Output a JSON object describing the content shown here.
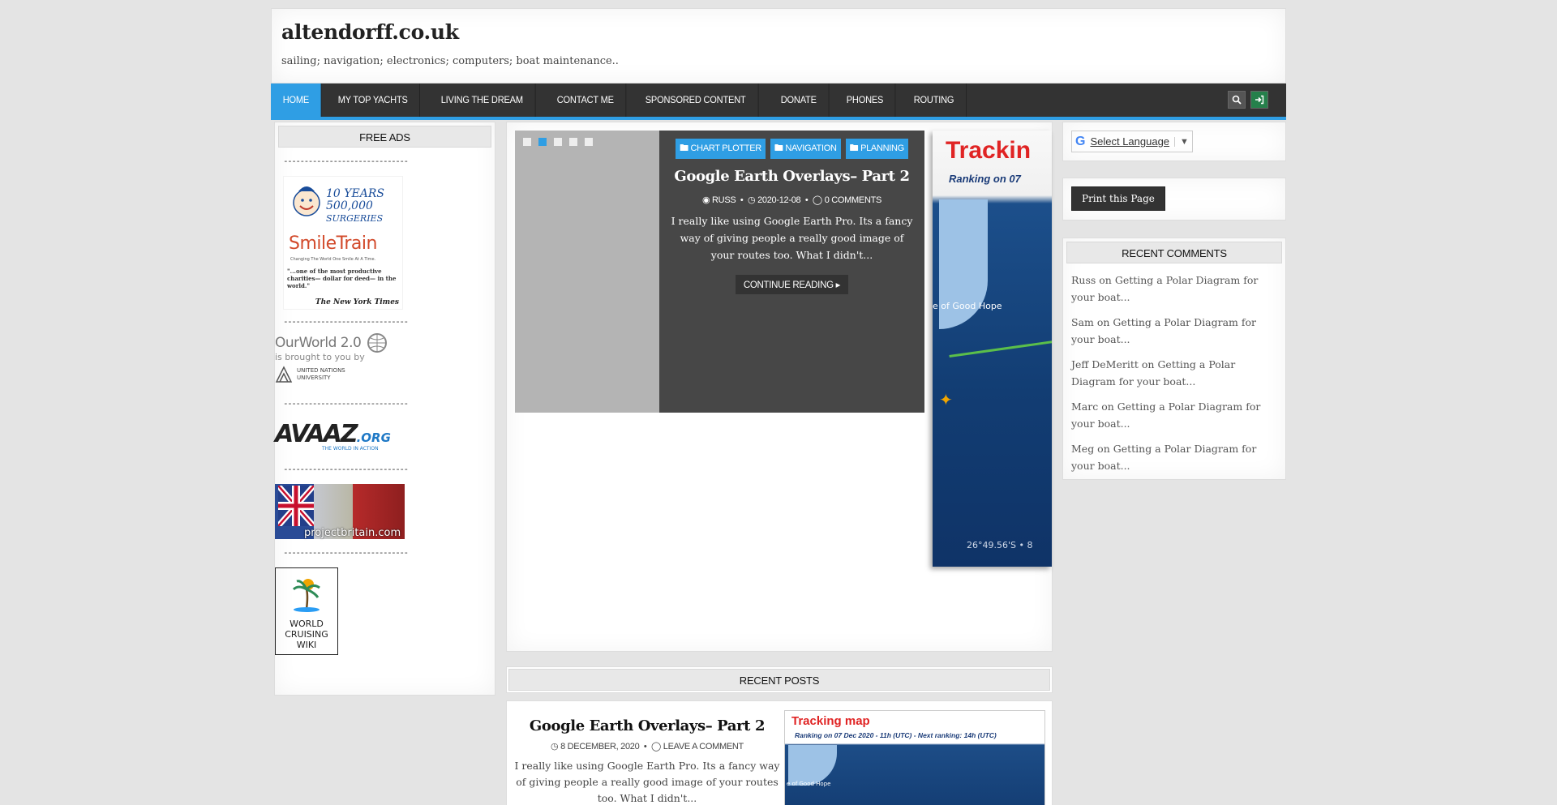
{
  "site": {
    "title": "altendorff.co.uk",
    "tagline": "sailing; navigation; electronics; computers; boat maintenance.."
  },
  "nav": {
    "items": [
      "Home",
      "My Top Yachts",
      "Living the Dream",
      "Contact Me",
      "Sponsored Content",
      "Donate",
      "Phones",
      "Routing"
    ],
    "active_index": 0,
    "search_icon": "search-icon",
    "login_icon": "login-icon"
  },
  "left_sidebar": {
    "title": "Free Ads",
    "divider": "------------------------------",
    "ads": {
      "smiletrain": {
        "line1": "10 YEARS",
        "line2": "500,000",
        "line3": "SURGERIES",
        "brand": "SmileTrain",
        "sub": "Changing The World One Smile At A Time.",
        "quote": "\"...one of the most productive charities— dollar for deed— in the world.\"",
        "source": "The New York Times"
      },
      "ourworld": {
        "line1": "OurWorld 2.0",
        "line2": "is brought to you by",
        "line3": "UNITED NATIONS",
        "line4": "UNIVERSITY"
      },
      "avaaz": {
        "brand": "AVAAZ",
        "suffix": ".ORG",
        "tagline": "THE WORLD IN ACTION"
      },
      "britain": {
        "caption": "projectbritain.com"
      },
      "wcw": {
        "text": "WORLD CRUISING WIKI"
      }
    }
  },
  "slider": {
    "dots": 5,
    "active_dot": 1,
    "categories": [
      "Chart Plotter",
      "Navigation",
      "Planning"
    ],
    "title": "Google Earth Overlays– Part 2",
    "author": "Russ",
    "date": "2020-12-08",
    "comments": "0 Comments",
    "excerpt": "I really like using Google Earth Pro. Its a fancy way of giving people a really good image of your routes too. What I didn't...",
    "button": "Continue Reading",
    "next_preview": {
      "title": "Trackin",
      "subtitle": "Ranking on 07",
      "place": "e of Good Hope",
      "coords": "26°49.56'S • 8"
    }
  },
  "recent_posts": {
    "title": "Recent Posts",
    "items": [
      {
        "title": "Google Earth Overlays– Part 2",
        "date": "8 December, 2020",
        "comment_link": "Leave a Comment",
        "excerpt": "I really like using Google Earth Pro. Its a fancy way of giving people a really good image of your routes too. What I didn't...",
        "thumb_title": "Tracking map",
        "thumb_subtitle": "Ranking on 07 Dec 2020 - 11h (UTC) - Next ranking: 14h (UTC)",
        "thumb_place": "e of Good Hope"
      }
    ]
  },
  "right_sidebar": {
    "language": {
      "label": "Select Language",
      "arrow": "▼",
      "logo": "G"
    },
    "print_button": "Print this Page",
    "recent_comments": {
      "title": "Recent Comments",
      "items": [
        {
          "author": "Russ",
          "sep": " on ",
          "post": "Getting a Polar Diagram for your boat..."
        },
        {
          "author": "Sam",
          "sep": " on ",
          "post": "Getting a Polar Diagram for your boat..."
        },
        {
          "author": "Jeff DeMeritt",
          "sep": " on ",
          "post": "Getting a Polar Diagram for your boat..."
        },
        {
          "author": "Marc",
          "sep": " on ",
          "post": "Getting a Polar Diagram for your boat..."
        },
        {
          "author": "Meg",
          "sep": " on ",
          "post": "Getting a Polar Diagram for your boat..."
        }
      ]
    }
  },
  "colors": {
    "accent": "#2f9ee4",
    "nav_bg": "#333333",
    "page_bg": "#e4e4e4",
    "login_green": "#25804b"
  }
}
